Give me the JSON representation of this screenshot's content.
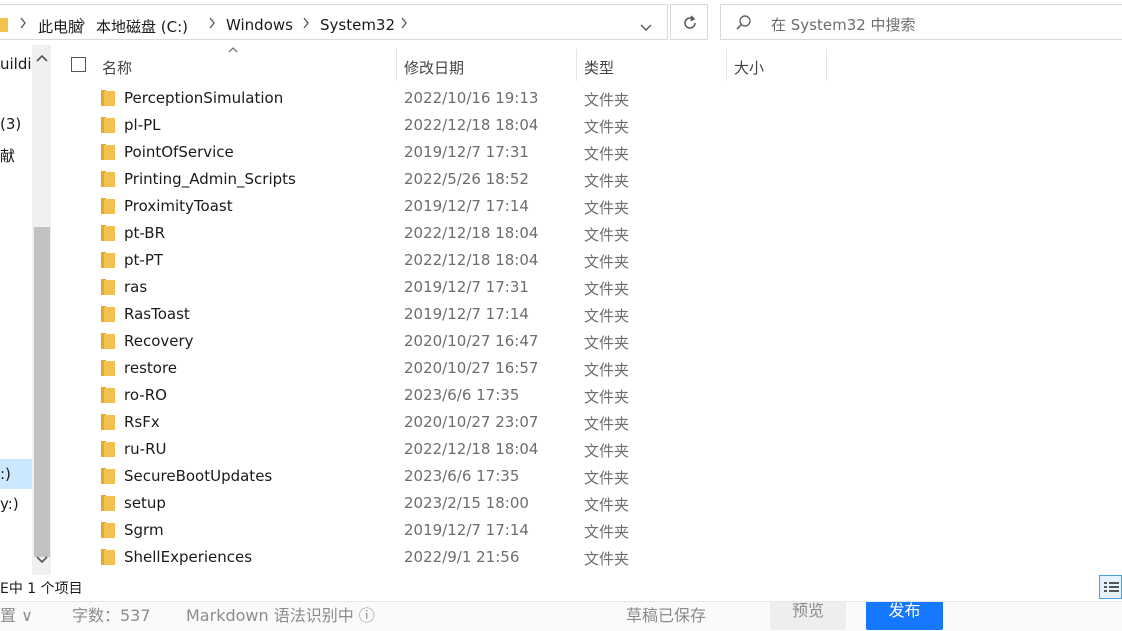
{
  "address_bar": {
    "breadcrumbs": [
      "此电脑",
      "本地磁盘 (C:)",
      "Windows",
      "System32"
    ]
  },
  "search": {
    "placeholder": "在 System32 中搜索"
  },
  "nav_pane": {
    "items": [
      "uildi",
      "(3)",
      "献",
      ":)",
      "y:)"
    ]
  },
  "columns": {
    "name": "名称",
    "date": "修改日期",
    "type": "类型",
    "size": "大小"
  },
  "files": [
    {
      "name": "PerceptionSimulation",
      "date": "2022/10/16 19:13",
      "type": "文件夹"
    },
    {
      "name": "pl-PL",
      "date": "2022/12/18 18:04",
      "type": "文件夹"
    },
    {
      "name": "PointOfService",
      "date": "2019/12/7 17:31",
      "type": "文件夹"
    },
    {
      "name": "Printing_Admin_Scripts",
      "date": "2022/5/26 18:52",
      "type": "文件夹"
    },
    {
      "name": "ProximityToast",
      "date": "2019/12/7 17:14",
      "type": "文件夹"
    },
    {
      "name": "pt-BR",
      "date": "2022/12/18 18:04",
      "type": "文件夹"
    },
    {
      "name": "pt-PT",
      "date": "2022/12/18 18:04",
      "type": "文件夹"
    },
    {
      "name": "ras",
      "date": "2019/12/7 17:31",
      "type": "文件夹"
    },
    {
      "name": "RasToast",
      "date": "2019/12/7 17:14",
      "type": "文件夹"
    },
    {
      "name": "Recovery",
      "date": "2020/10/27 16:47",
      "type": "文件夹"
    },
    {
      "name": "restore",
      "date": "2020/10/27 16:57",
      "type": "文件夹"
    },
    {
      "name": "ro-RO",
      "date": "2023/6/6 17:35",
      "type": "文件夹"
    },
    {
      "name": "RsFx",
      "date": "2020/10/27 23:07",
      "type": "文件夹"
    },
    {
      "name": "ru-RU",
      "date": "2022/12/18 18:04",
      "type": "文件夹"
    },
    {
      "name": "SecureBootUpdates",
      "date": "2023/6/6 17:35",
      "type": "文件夹"
    },
    {
      "name": "setup",
      "date": "2023/2/15 18:00",
      "type": "文件夹"
    },
    {
      "name": "Sgrm",
      "date": "2019/12/7 17:14",
      "type": "文件夹"
    },
    {
      "name": "ShellExperiences",
      "date": "2022/9/1 21:56",
      "type": "文件夹"
    }
  ],
  "status_bar": {
    "text": "E中 1 个项目"
  },
  "editor_strip": {
    "left_label": "置 ∨",
    "word_count": "字数：537",
    "syntax": "Markdown 语法识别中 ⓘ",
    "draft_saved": "草稿已保存",
    "preview": "预览",
    "publish": "发布"
  },
  "colors": {
    "folder": "#f2c14e",
    "selection": "#cce8ff",
    "publish_button": "#1677ff"
  }
}
